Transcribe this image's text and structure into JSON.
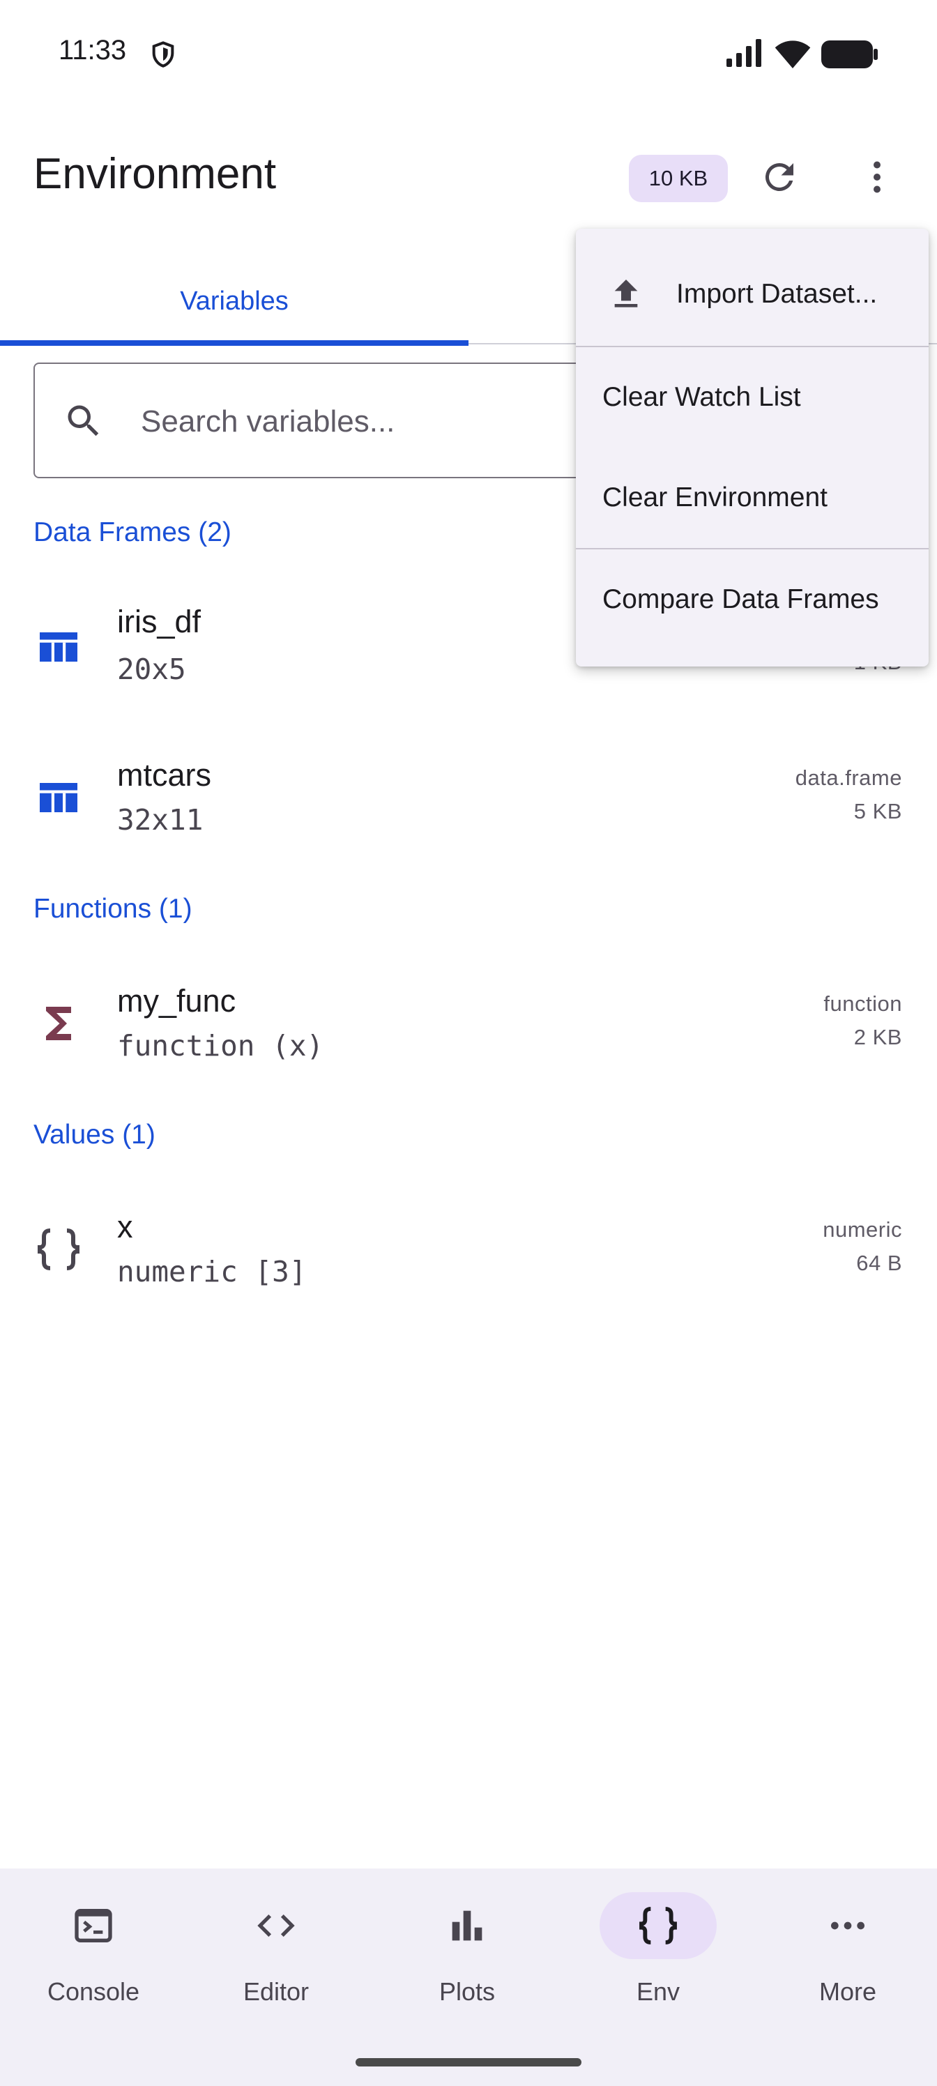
{
  "status_bar": {
    "time": "11:33"
  },
  "app_bar": {
    "title": "Environment",
    "memory_badge": "10 KB"
  },
  "tabs": [
    {
      "label": "Variables",
      "selected": true
    }
  ],
  "search": {
    "placeholder": "Search variables..."
  },
  "sections": [
    {
      "header": "Data Frames (2)",
      "items": [
        {
          "name": "iris_df",
          "description": "20x5",
          "type": "",
          "size": "1 KB",
          "icon": "table-icon"
        },
        {
          "name": "mtcars",
          "description": "32x11",
          "type": "data.frame",
          "size": "5 KB",
          "icon": "table-icon"
        }
      ]
    },
    {
      "header": "Functions (1)",
      "items": [
        {
          "name": "my_func",
          "description": "function (x)",
          "type": "function",
          "size": "2 KB",
          "icon": "sigma-icon"
        }
      ]
    },
    {
      "header": "Values (1)",
      "items": [
        {
          "name": "x",
          "description": "numeric [3]",
          "type": "numeric",
          "size": "64 B",
          "icon": "braces-icon"
        }
      ]
    }
  ],
  "menu": {
    "items": [
      {
        "label": "Import Dataset...",
        "icon": "upload-icon"
      },
      {
        "label": "Clear Watch List"
      },
      {
        "label": "Clear Environment"
      },
      {
        "label": "Compare Data Frames"
      }
    ]
  },
  "bottom_nav": {
    "items": [
      {
        "label": "Console",
        "icon": "terminal-icon"
      },
      {
        "label": "Editor",
        "icon": "code-icon"
      },
      {
        "label": "Plots",
        "icon": "bar-chart-icon"
      },
      {
        "label": "Env",
        "icon": "braces-icon",
        "active": true
      },
      {
        "label": "More",
        "icon": "more-horiz-icon"
      }
    ]
  },
  "colors": {
    "accent": "#1a4fd6",
    "badge_bg": "#e8def8",
    "function_icon": "#7a3b4f",
    "nav_bg": "#f1eff7"
  }
}
